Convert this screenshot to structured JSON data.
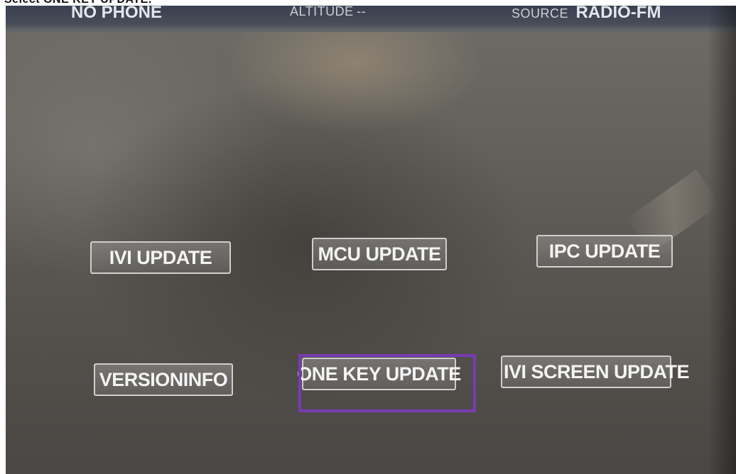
{
  "instruction": "Select ONE KEY UPDATE.",
  "status_bar": {
    "phone": "NO PHONE",
    "altitude_label": "ALTITUDE",
    "altitude_value": "--",
    "source_label": "SOURCE",
    "source_value": "RADIO-FM"
  },
  "buttons": {
    "ivi_update": "IVI UPDATE",
    "mcu_update": "MCU UPDATE",
    "ipc_update": "IPC UPDATE",
    "version_info": "VERSIONINFO",
    "one_key_update": "ONE KEY UPDATE",
    "ivi_screen_update": "IVI SCREEN UPDATE"
  },
  "highlight_color": "#7a3bb0"
}
